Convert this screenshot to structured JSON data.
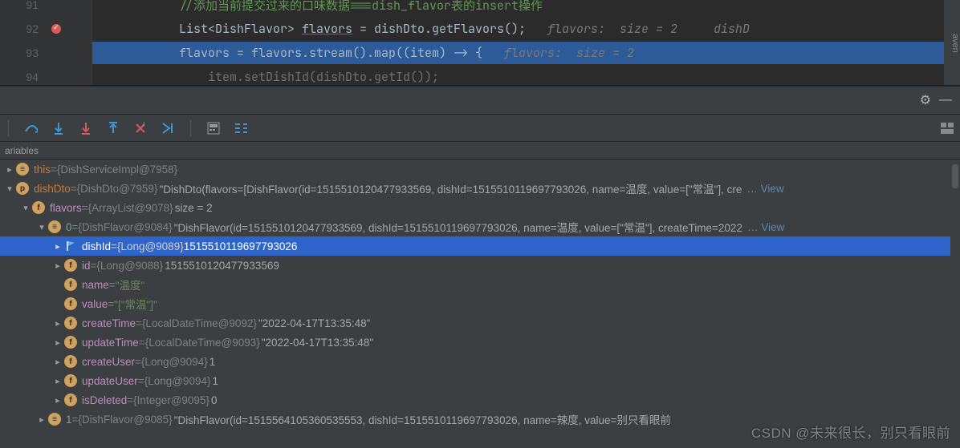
{
  "editor": {
    "lines": {
      "91": {
        "num": "91",
        "text": "//添加当前提交过来的口味数据===dish_flavor表的insert操作"
      },
      "92": {
        "num": "92",
        "p1": "List<DishFlavor> ",
        "p2": "flavors",
        "p3": " = dishDto.getFlavors();",
        "hint": "   flavors:  size = 2     dishD"
      },
      "93": {
        "num": "93",
        "p1": "flavors = flavors.stream().map((item) -> {",
        "hint": "   flavors:  size = 2"
      },
      "94": {
        "num": "94",
        "p1": "    item.setDishId(dishDto.getId());"
      }
    },
    "sidetab": "aven"
  },
  "variables_header": "ariables",
  "rows": {
    "this": {
      "name": "this",
      "eq": " = ",
      "ref": "{DishServiceImpl@7958}"
    },
    "dishDto": {
      "name": "dishDto",
      "eq": " = ",
      "ref": "{DishDto@7959}",
      "str": " \"DishDto(flavors=[DishFlavor(id=1515510120477933569, dishId=1515510119697793026, name=温度, value=[\"常温\"], cre",
      "view": "… View"
    },
    "flavors": {
      "name": "flavors",
      "eq": " = ",
      "ref": "{ArrayList@9078}",
      "size": "  size = 2"
    },
    "idx0": {
      "name": "0",
      "eq": " = ",
      "ref": "{DishFlavor@9084}",
      "str": " \"DishFlavor(id=1515510120477933569, dishId=1515510119697793026, name=温度, value=[\"常温\"], createTime=2022",
      "view": "… View"
    },
    "dishId": {
      "name": "dishId",
      "eq": " = ",
      "ref": "{Long@9089}",
      "val": " 1515510119697793026"
    },
    "id": {
      "name": "id",
      "eq": " = ",
      "ref": "{Long@9088}",
      "val": " 1515510120477933569"
    },
    "nameField": {
      "name": "name",
      "eq": " = ",
      "val": "\"温度\""
    },
    "valueField": {
      "name": "value",
      "eq": " = ",
      "val": "\"[\"常温\"]\""
    },
    "createTime": {
      "name": "createTime",
      "eq": " = ",
      "ref": "{LocalDateTime@9092}",
      "val": " \"2022-04-17T13:35:48\""
    },
    "updateTime": {
      "name": "updateTime",
      "eq": " = ",
      "ref": "{LocalDateTime@9093}",
      "val": " \"2022-04-17T13:35:48\""
    },
    "createUser": {
      "name": "createUser",
      "eq": " = ",
      "ref": "{Long@9094}",
      "val": " 1"
    },
    "updateUser": {
      "name": "updateUser",
      "eq": " = ",
      "ref": "{Long@9094}",
      "val": " 1"
    },
    "isDeleted": {
      "name": "isDeleted",
      "eq": " = ",
      "ref": "{Integer@9095}",
      "val": " 0"
    },
    "idx1": {
      "name": "1",
      "eq": " = ",
      "ref": "{DishFlavor@9085}",
      "str": " \"DishFlavor(id=1515564105360535553, dishId=1515510119697793026, name=辣度, value=别只看眼前"
    }
  },
  "watermark": "CSDN @未来很长，别只看眼前"
}
